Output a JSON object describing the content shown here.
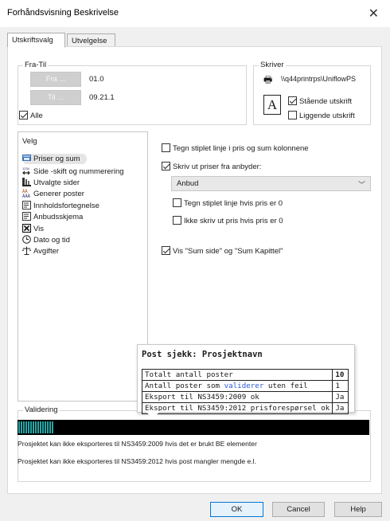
{
  "window": {
    "title": "Forhåndsvisning Beskrivelse"
  },
  "tabs": [
    {
      "label": "Utskriftsvalg",
      "active": true
    },
    {
      "label": "Utvelgelse",
      "active": false
    }
  ],
  "fratil": {
    "legend": "Fra-Til",
    "fra_button": "Fra ...",
    "fra_value": "01.0",
    "til_button": "Til ...",
    "til_value": "09.21.1",
    "alle_label": "Alle",
    "alle_checked": true
  },
  "skriver": {
    "legend": "Skriver",
    "printer_name": "\\\\q44printrps\\UniflowPS",
    "stående_label": "Stående utskrift",
    "stående_checked": true,
    "liggende_label": "Liggende utskrift",
    "liggende_checked": false
  },
  "velg": {
    "legend": "Velg",
    "items": [
      {
        "label": "Priser og sum",
        "icon": "price-sum-icon",
        "selected": true
      },
      {
        "label": "Side -skift og nummerering",
        "icon": "page-numbering-icon"
      },
      {
        "label": "Utvalgte sider",
        "icon": "selected-pages-icon"
      },
      {
        "label": "Generer poster",
        "icon": "generate-items-icon"
      },
      {
        "label": "Innholdsfortegnelse",
        "icon": "table-of-contents-icon"
      },
      {
        "label": "Anbudsskjema",
        "icon": "tender-form-icon"
      },
      {
        "label": "Vis",
        "icon": "view-icon"
      },
      {
        "label": "Dato og tid",
        "icon": "clock-icon"
      },
      {
        "label": "Avgifter",
        "icon": "scales-icon"
      }
    ]
  },
  "options": {
    "stiplet_sum": {
      "label": "Tegn stiplet linje i pris og sum kolonnene",
      "checked": false
    },
    "skriv_priser": {
      "label": "Skriv ut priser fra anbyder:",
      "checked": true
    },
    "anbyder_selected": "Anbud",
    "stiplet_pris0": {
      "label": "Tegn stiplet linje hvis pris er 0",
      "checked": false
    },
    "ikke_skriv_pris0": {
      "label": "Ikke skriv ut pris hvis pris er 0",
      "checked": false
    },
    "vis_sum": {
      "label": "Vis \"Sum side\" og \"Sum Kapittel\"",
      "checked": true
    }
  },
  "tooltip": {
    "title": "Post sjekk: Prosjektnavn",
    "rows": [
      {
        "label": "Totalt antall poster",
        "value": "10"
      },
      {
        "label_pre": "Antall poster som ",
        "label_link": "validerer",
        "label_post": " uten feil",
        "value": "1"
      },
      {
        "label": "Eksport til NS3459:2009 ok",
        "value": "Ja"
      },
      {
        "label": "Eksport til NS3459:2012 prisforespørsel ok",
        "value": "Ja"
      }
    ]
  },
  "validering": {
    "legend": "Validering",
    "progress_fraction": 0.1,
    "progress_color": "#26a7a7",
    "messages": [
      "Prosjektet kan ikke eksporteres til NS3459:2009 hvis det er brukt BE elementer",
      "Prosjektet kan ikke eksporteres til NS3459:2012 hvis post mangler mengde e.l."
    ]
  },
  "footer": {
    "ok": "OK",
    "cancel": "Cancel",
    "help": "Help"
  }
}
